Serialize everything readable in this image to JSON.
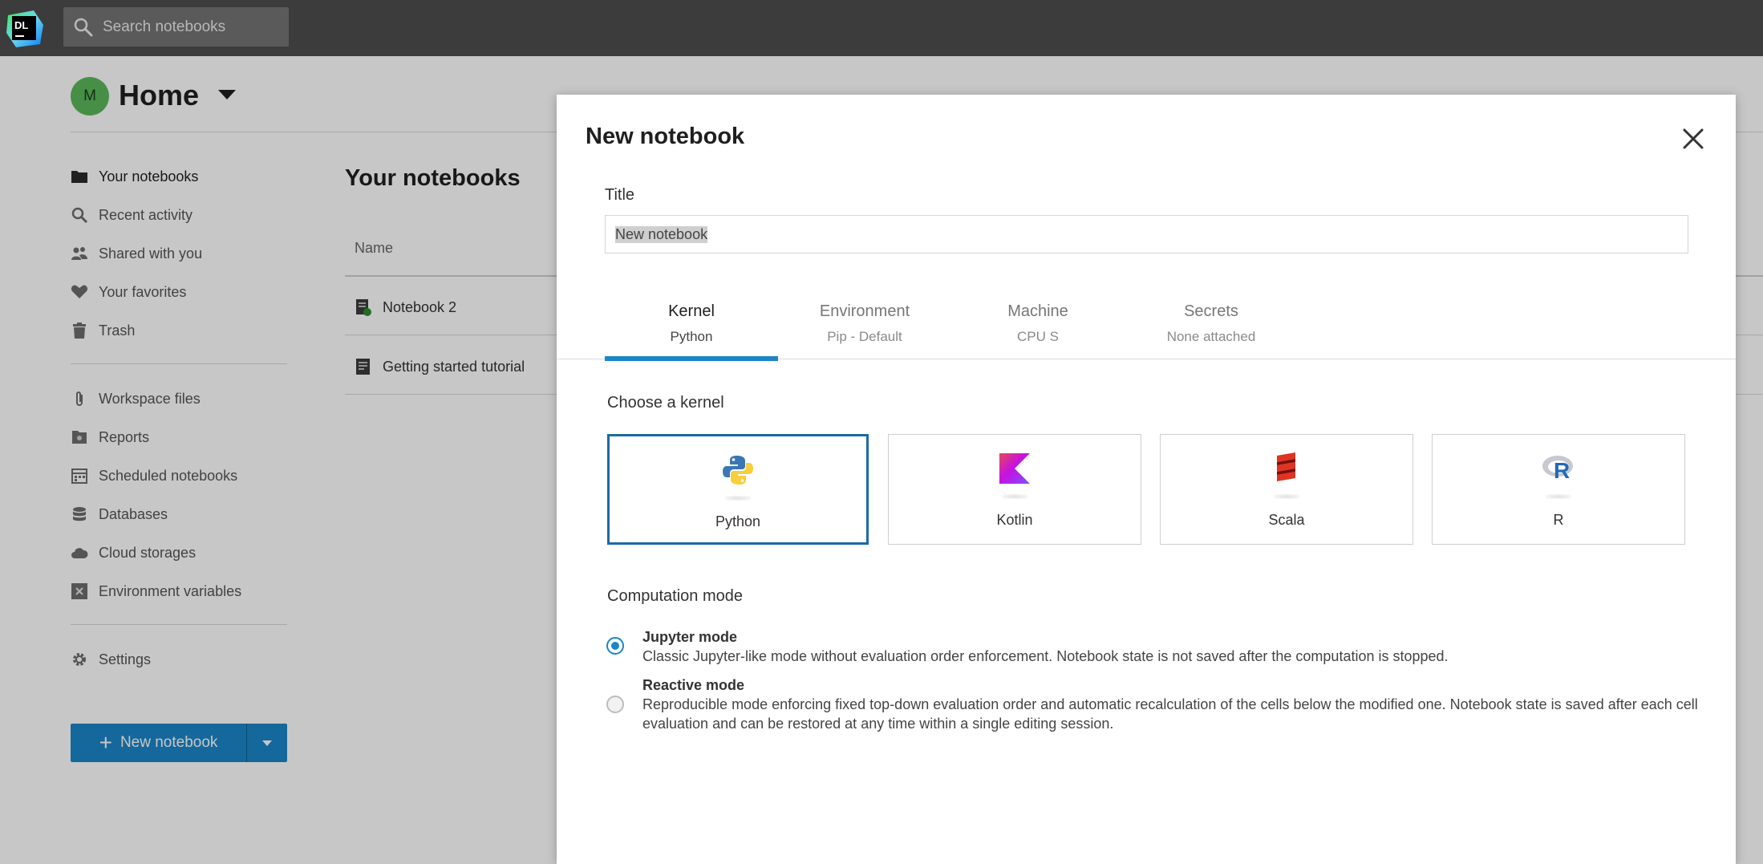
{
  "topbar": {
    "logo_text": "DL",
    "search_placeholder": "Search notebooks"
  },
  "home": {
    "avatar_initial": "M",
    "title": "Home"
  },
  "sidebar": {
    "items": [
      {
        "label": "Your notebooks",
        "icon": "folder-icon"
      },
      {
        "label": "Recent activity",
        "icon": "recent-icon"
      },
      {
        "label": "Shared with you",
        "icon": "people-icon"
      },
      {
        "label": "Your favorites",
        "icon": "heart-icon"
      },
      {
        "label": "Trash",
        "icon": "trash-icon"
      },
      {
        "label": "Workspace files",
        "icon": "paperclip-icon"
      },
      {
        "label": "Reports",
        "icon": "report-icon"
      },
      {
        "label": "Scheduled notebooks",
        "icon": "calendar-icon"
      },
      {
        "label": "Databases",
        "icon": "database-icon"
      },
      {
        "label": "Cloud storages",
        "icon": "cloud-icon"
      },
      {
        "label": "Environment variables",
        "icon": "env-var-icon"
      },
      {
        "label": "Settings",
        "icon": "gear-icon"
      }
    ],
    "new_notebook_label": "New notebook"
  },
  "notebooks": {
    "title": "Your notebooks",
    "column_name": "Name",
    "rows": [
      {
        "name": "Notebook 2"
      },
      {
        "name": "Getting started tutorial"
      }
    ]
  },
  "modal": {
    "title": "New notebook",
    "title_label": "Title",
    "title_value": "New notebook",
    "tabs": [
      {
        "label": "Kernel",
        "value": "Python"
      },
      {
        "label": "Environment",
        "value": "Pip - Default"
      },
      {
        "label": "Machine",
        "value": "CPU S"
      },
      {
        "label": "Secrets",
        "value": "None attached"
      }
    ],
    "kernel_heading": "Choose a kernel",
    "kernels": [
      {
        "name": "Python",
        "icon": "python-icon"
      },
      {
        "name": "Kotlin",
        "icon": "kotlin-icon"
      },
      {
        "name": "Scala",
        "icon": "scala-icon"
      },
      {
        "name": "R",
        "icon": "r-icon"
      }
    ],
    "computation_heading": "Computation mode",
    "modes": [
      {
        "name": "Jupyter mode",
        "description": "Classic Jupyter-like mode without evaluation order enforcement. Notebook state is not saved after the computation is stopped."
      },
      {
        "name": "Reactive mode",
        "description": "Reproducible mode enforcing fixed top-down evaluation order and automatic recalculation of the cells below the modified one. Notebook state is saved after each cell evaluation and can be restored at any time within a single editing session."
      }
    ]
  },
  "colors": {
    "accent": "#1b86c8",
    "topbar": "#3c3c3c",
    "selected_border": "#1b6aa3"
  }
}
